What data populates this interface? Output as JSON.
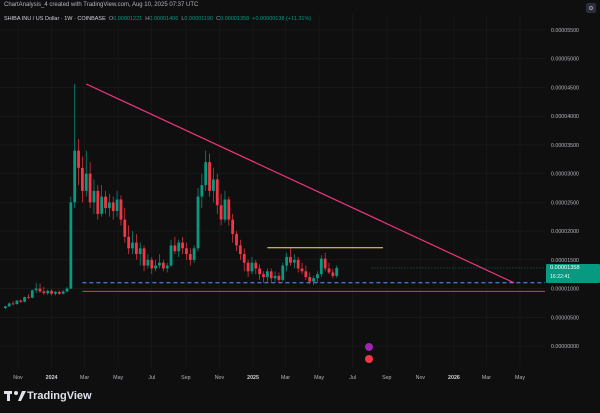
{
  "header": {
    "title": "ChartAnalysis_4 created with TradingView.com, Aug 10, 2025 07:37 UTC"
  },
  "legend": {
    "symbol": "SHIBA INU / US Dollar · 1W · COINBASE",
    "o_label": "O",
    "o_value": "0.00001221",
    "h_label": "H",
    "h_value": "0.00001406",
    "l_label": "L",
    "l_value": "0.00001190",
    "c_label": "C",
    "c_value": "0.00001358",
    "change": "+0.00000138 (+11.31%)"
  },
  "current_price": {
    "price": "0.00001358",
    "countdown": "16:22:41",
    "color": "#089981"
  },
  "footer": {
    "brand": "TradingView"
  },
  "colors": {
    "up": "#089981",
    "down": "#f23645",
    "trendline": "#f2367e",
    "resistance": "#ffeb3b",
    "support_dashed": "#5b9cf6",
    "support_solid": "#f23645"
  },
  "chart_data": {
    "type": "candlestick",
    "title": "",
    "ylim": [
      0,
      5.7e-06
    ],
    "y_ticks": [
      "0.00000000",
      "0.00000500",
      "0.00001000",
      "0.00001500",
      "0.00002000",
      "0.00002500",
      "0.00003000",
      "0.00003500",
      "0.00004000",
      "0.00004500",
      "0.00005000",
      "0.00005500"
    ],
    "y_tick_values": [
      0,
      5e-06,
      1e-05,
      1.5e-05,
      2e-05,
      2.5e-05,
      3e-05,
      3.5e-05,
      4e-05,
      4.5e-05,
      5e-05,
      5.5e-05
    ],
    "x_ticks": [
      {
        "label": "Nov",
        "date": "2023-11-01"
      },
      {
        "label": "2024",
        "date": "2024-01-01",
        "bold": true
      },
      {
        "label": "Mar",
        "date": "2024-03-01"
      },
      {
        "label": "May",
        "date": "2024-05-01"
      },
      {
        "label": "Jul",
        "date": "2024-07-01"
      },
      {
        "label": "Sep",
        "date": "2024-09-01"
      },
      {
        "label": "Nov",
        "date": "2024-11-01"
      },
      {
        "label": "2025",
        "date": "2025-01-01",
        "bold": true
      },
      {
        "label": "Mar",
        "date": "2025-03-01"
      },
      {
        "label": "May",
        "date": "2025-05-01"
      },
      {
        "label": "Jul",
        "date": "2025-07-01"
      },
      {
        "label": "Sep",
        "date": "2025-09-01"
      },
      {
        "label": "Nov",
        "date": "2025-11-01"
      },
      {
        "label": "2026",
        "date": "2026-01-01",
        "bold": true
      },
      {
        "label": "Mar",
        "date": "2026-03-01"
      },
      {
        "label": "May",
        "date": "2026-05-01"
      }
    ],
    "candles_weekly_from": "2023-10-09",
    "candles": [
      [
        6.6e-06,
        7e-06,
        6.4e-06,
        6.9e-06
      ],
      [
        6.9e-06,
        7.6e-06,
        6.8e-06,
        7.4e-06
      ],
      [
        7.4e-06,
        7.8e-06,
        7.1e-06,
        7.3e-06
      ],
      [
        7.3e-06,
        8e-06,
        7.2e-06,
        7.9e-06
      ],
      [
        7.9e-06,
        8.1e-06,
        7.5e-06,
        7.7e-06
      ],
      [
        7.7e-06,
        8.6e-06,
        7.6e-06,
        8.5e-06
      ],
      [
        8.5e-06,
        9e-06,
        8.2e-06,
        8.4e-06
      ],
      [
        8.4e-06,
        9.8e-06,
        8.3e-06,
        9.7e-06
      ],
      [
        9.7e-06,
        1.1e-05,
        9.2e-06,
        1e-05
      ],
      [
        1e-05,
        1.09e-05,
        9.3e-06,
        9.5e-06
      ],
      [
        9.5e-06,
        1.03e-05,
        8.9e-06,
        9.2e-06
      ],
      [
        9.2e-06,
        9.8e-06,
        8.9e-06,
        9.6e-06
      ],
      [
        9.6e-06,
        9.9e-06,
        8.8e-06,
        9.1e-06
      ],
      [
        9.1e-06,
        9.6e-06,
        8.8e-06,
        9.4e-06
      ],
      [
        9.4e-06,
        9.7e-06,
        8.9e-06,
        9.1e-06
      ],
      [
        9.1e-06,
        9.7e-06,
        9e-06,
        9.5e-06
      ],
      [
        9.5e-06,
        1.03e-05,
        9.3e-06,
        1e-05
      ],
      [
        1e-05,
        2.6e-05,
        9.9e-06,
        2.5e-05
      ],
      [
        2.5e-05,
        4.56e-05,
        2.4e-05,
        3.4e-05
      ],
      [
        3.4e-05,
        3.6e-05,
        2.8e-05,
        3.1e-05
      ],
      [
        3.1e-05,
        3.3e-05,
        2.5e-05,
        2.7e-05
      ],
      [
        2.7e-05,
        3.4e-05,
        2.6e-05,
        3e-05
      ],
      [
        3e-05,
        3.2e-05,
        2.4e-05,
        2.5e-05
      ],
      [
        2.5e-05,
        2.9e-05,
        2.3e-05,
        2.7e-05
      ],
      [
        2.7e-05,
        2.8e-05,
        2.2e-05,
        2.3e-05
      ],
      [
        2.3e-05,
        2.8e-05,
        2.25e-05,
        2.6e-05
      ],
      [
        2.6e-05,
        2.7e-05,
        2.3e-05,
        2.4e-05
      ],
      [
        2.4e-05,
        2.65e-05,
        2.25e-05,
        2.5e-05
      ],
      [
        2.5e-05,
        2.6e-05,
        2.2e-05,
        2.35e-05
      ],
      [
        2.35e-05,
        2.7e-05,
        2.25e-05,
        2.55e-05
      ],
      [
        2.55e-05,
        2.62e-05,
        2.1e-05,
        2.2e-05
      ],
      [
        2.2e-05,
        2.4e-05,
        1.8e-05,
        1.9e-05
      ],
      [
        1.9e-05,
        2.1e-05,
        1.6e-05,
        1.7e-05
      ],
      [
        1.7e-05,
        2e-05,
        1.6e-05,
        1.8e-05
      ],
      [
        1.8e-05,
        1.95e-05,
        1.5e-05,
        1.6e-05
      ],
      [
        1.6e-05,
        1.8e-05,
        1.4e-05,
        1.7e-05
      ],
      [
        1.7e-05,
        1.75e-05,
        1.3e-05,
        1.4e-05
      ],
      [
        1.4e-05,
        1.6e-05,
        1.35e-05,
        1.5e-05
      ],
      [
        1.5e-05,
        1.55e-05,
        1.25e-05,
        1.35e-05
      ],
      [
        1.35e-05,
        1.5e-05,
        1.3e-05,
        1.4e-05
      ],
      [
        1.4e-05,
        1.6e-05,
        1.35e-05,
        1.45e-05
      ],
      [
        1.45e-05,
        1.5e-05,
        1.3e-05,
        1.35e-05
      ],
      [
        1.35e-05,
        1.45e-05,
        1.28e-05,
        1.4e-05
      ],
      [
        1.4e-05,
        1.85e-05,
        1.38e-05,
        1.75e-05
      ],
      [
        1.75e-05,
        1.9e-05,
        1.6e-05,
        1.65e-05
      ],
      [
        1.65e-05,
        1.85e-05,
        1.55e-05,
        1.8e-05
      ],
      [
        1.8e-05,
        1.9e-05,
        1.6e-05,
        1.7e-05
      ],
      [
        1.7e-05,
        1.8e-05,
        1.5e-05,
        1.6e-05
      ],
      [
        1.6e-05,
        1.7e-05,
        1.4e-05,
        1.5e-05
      ],
      [
        1.5e-05,
        1.75e-05,
        1.45e-05,
        1.7e-05
      ],
      [
        1.7e-05,
        2.75e-05,
        1.65e-05,
        2.6e-05
      ],
      [
        2.6e-05,
        3e-05,
        2.4e-05,
        2.8e-05
      ],
      [
        2.8e-05,
        3.4e-05,
        2.7e-05,
        3.2e-05
      ],
      [
        3.2e-05,
        3.35e-05,
        2.6e-05,
        2.7e-05
      ],
      [
        2.7e-05,
        3.1e-05,
        2.5e-05,
        2.9e-05
      ],
      [
        2.9e-05,
        3e-05,
        2.3e-05,
        2.45e-05
      ],
      [
        2.45e-05,
        2.65e-05,
        2.1e-05,
        2.2e-05
      ],
      [
        2.2e-05,
        2.7e-05,
        2.15e-05,
        2.55e-05
      ],
      [
        2.55e-05,
        2.6e-05,
        2.1e-05,
        2.2e-05
      ],
      [
        2.2e-05,
        2.3e-05,
        1.8e-05,
        1.95e-05
      ],
      [
        1.95e-05,
        2e-05,
        1.65e-05,
        1.75e-05
      ],
      [
        1.75e-05,
        1.85e-05,
        1.5e-05,
        1.6e-05
      ],
      [
        1.6e-05,
        1.7e-05,
        1.3e-05,
        1.45e-05
      ],
      [
        1.45e-05,
        1.5e-05,
        1.2e-05,
        1.3e-05
      ],
      [
        1.3e-05,
        1.55e-05,
        1.25e-05,
        1.45e-05
      ],
      [
        1.45e-05,
        1.5e-05,
        1.25e-05,
        1.35e-05
      ],
      [
        1.35e-05,
        1.42e-05,
        1.15e-05,
        1.25e-05
      ],
      [
        1.25e-05,
        1.3e-05,
        1.1e-05,
        1.2e-05
      ],
      [
        1.2e-05,
        1.35e-05,
        1.12e-05,
        1.3e-05
      ],
      [
        1.3e-05,
        1.35e-05,
        1.1e-05,
        1.18e-05
      ],
      [
        1.18e-05,
        1.3e-05,
        1.12e-05,
        1.22e-05
      ],
      [
        1.22e-05,
        1.28e-05,
        1.1e-05,
        1.15e-05
      ],
      [
        1.15e-05,
        1.45e-05,
        1.12e-05,
        1.4e-05
      ],
      [
        1.4e-05,
        1.62e-05,
        1.3e-05,
        1.55e-05
      ],
      [
        1.55e-05,
        1.7e-05,
        1.4e-05,
        1.45e-05
      ],
      [
        1.45e-05,
        1.6e-05,
        1.35e-05,
        1.5e-05
      ],
      [
        1.5e-05,
        1.55e-05,
        1.28e-05,
        1.35e-05
      ],
      [
        1.35e-05,
        1.45e-05,
        1.25e-05,
        1.3e-05
      ],
      [
        1.3e-05,
        1.4e-05,
        1.15e-05,
        1.2e-05
      ],
      [
        1.2e-05,
        1.28e-05,
        1.08e-05,
        1.12e-05
      ],
      [
        1.12e-05,
        1.22e-05,
        1.06e-05,
        1.18e-05
      ],
      [
        1.18e-05,
        1.3e-05,
        1.1e-05,
        1.25e-05
      ],
      [
        1.25e-05,
        1.58e-05,
        1.2e-05,
        1.52e-05
      ],
      [
        1.52e-05,
        1.62e-05,
        1.3e-05,
        1.35e-05
      ],
      [
        1.35e-05,
        1.45e-05,
        1.25e-05,
        1.28e-05
      ],
      [
        1.28e-05,
        1.34e-05,
        1.18e-05,
        1.22e-05
      ],
      [
        1.22e-05,
        1.4e-05,
        1.19e-05,
        1.36e-05
      ]
    ],
    "drawings": {
      "descending_trendline": {
        "from": {
          "date": "2024-03-04",
          "price": 4.56e-05
        },
        "to": {
          "date": "2026-04-20",
          "price": 1.1e-05
        }
      },
      "resistance_line": {
        "from": {
          "date": "2025-01-27",
          "price": 1.71e-05
        },
        "to": {
          "date": "2025-08-25",
          "price": 1.71e-05
        },
        "color": "yellow"
      },
      "support_dashed": {
        "price": 1.1e-05,
        "from_date": "2024-02-26"
      },
      "support_solid": {
        "price": 9.5e-06,
        "from_date": "2024-02-26"
      }
    }
  }
}
